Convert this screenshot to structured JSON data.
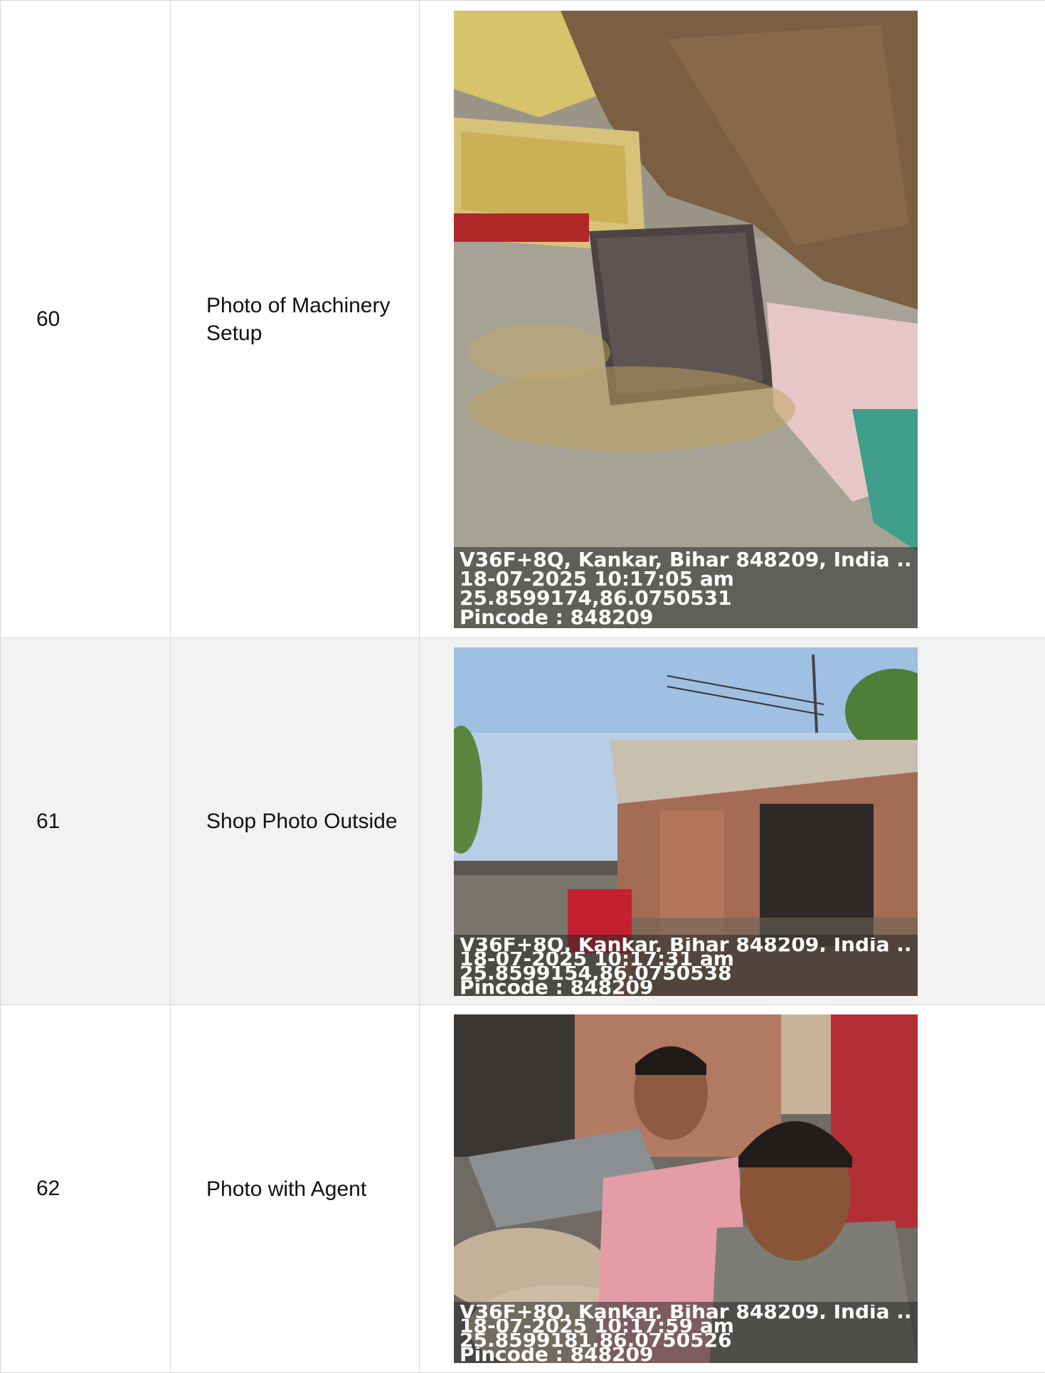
{
  "rows": [
    {
      "number": "60",
      "label": "Photo of Machinery Setup",
      "photo": {
        "subject": "weighing-scale-among-grain-sacks",
        "address": "V36F+8Q, Kankar, Bihar 848209, India ...",
        "datetime": "18-07-2025 10:17:05 am",
        "coords": "25.8599174,86.0750531",
        "pincode": "Pincode : 848209"
      }
    },
    {
      "number": "61",
      "label": "Shop Photo Outside",
      "photo": {
        "subject": "brick-shop-building-exterior",
        "address": "V36F+8Q, Kankar, Bihar 848209, India ...",
        "datetime": "18-07-2025 10:17:31 am",
        "coords": "25.8599154,86.0750538",
        "pincode": "Pincode : 848209"
      }
    },
    {
      "number": "62",
      "label": "Photo with Agent",
      "photo": {
        "subject": "two-men-selfie-near-sacks",
        "address": "V36F+8Q, Kankar, Bihar 848209, India ...",
        "datetime": "18-07-2025 10:17:59 am",
        "coords": "25.8599181,86.0750526",
        "pincode": "Pincode : 848209"
      }
    }
  ]
}
